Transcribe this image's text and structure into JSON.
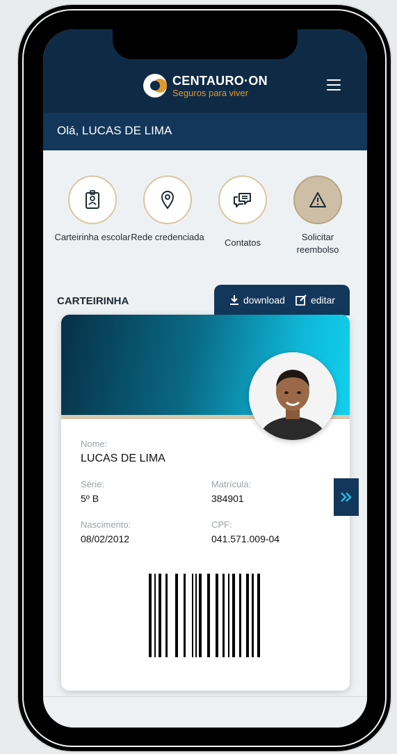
{
  "header": {
    "brand_title": "CENTAURO·ON",
    "brand_tagline": "Seguros para viver",
    "menu_icon": "hamburger-menu-icon"
  },
  "greeting": "Olá, LUCAS DE LIMA",
  "actions": [
    {
      "label": "Carteirinha escolar",
      "icon": "id-badge-icon"
    },
    {
      "label": "Rede credenciada",
      "icon": "map-pin-icon"
    },
    {
      "label": "Contatos",
      "icon": "chat-bubbles-icon"
    },
    {
      "label": "Solicitar reembolso",
      "icon": "warning-icon"
    }
  ],
  "card_section": {
    "title": "CARTEIRINHA",
    "download_label": "download",
    "edit_label": "editar"
  },
  "card": {
    "name_label": "Nome:",
    "name_value": "LUCAS DE LIMA",
    "serie_label": "Série:",
    "serie_value": "5º B",
    "matricula_label": "Matrícula:",
    "matricula_value": "384901",
    "nascimento_label": "Nascimento:",
    "nascimento_value": "08/02/2012",
    "cpf_label": "CPF:",
    "cpf_value": "041.571.009-04"
  },
  "colors": {
    "navy": "#0f2a45",
    "accent_gold": "#e09a2a",
    "cyan": "#11d1ee"
  }
}
